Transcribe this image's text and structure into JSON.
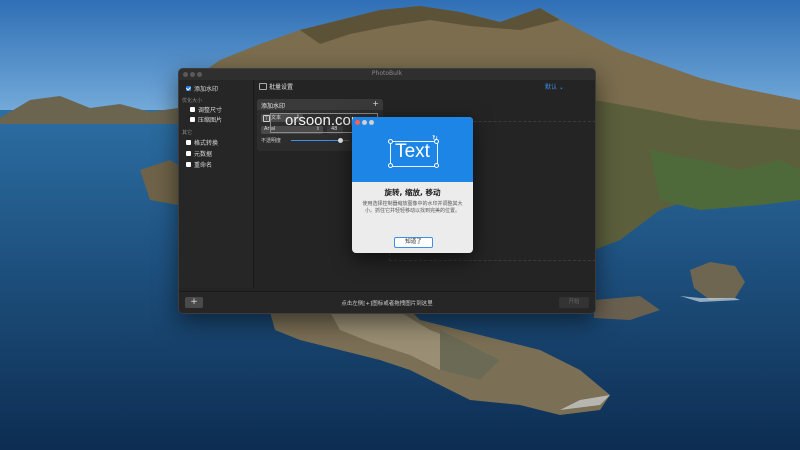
{
  "window": {
    "title": "PhotoBulk"
  },
  "sidebar": {
    "top_item": "添加水印",
    "section_resize": "调整尺寸",
    "resize_items": [
      "调整尺寸",
      "压缩图片"
    ],
    "section_other": "其它",
    "other_items": [
      "格式转换",
      "元数据",
      "重命名"
    ],
    "section_optimize": "优化大小"
  },
  "panel": {
    "title": "批量设置",
    "default_label": "默认 ⌄",
    "watermark_header": "添加水印",
    "type_label": "文本",
    "font_label": "Arial",
    "font_size": "48",
    "opacity_label": "不透明度",
    "opacity_value": 0.85
  },
  "preview": {
    "watermark_text": "orsoon.com"
  },
  "bottombar": {
    "add_label": "+",
    "hint": "点击左侧[+]图标或者拖拽图片到这里",
    "start_label": "开始"
  },
  "dialog": {
    "hero_text": "Text",
    "title": "旋转, 缩放, 移动",
    "body": "使用选择控制器缩放图像中的水印并调整其大小。抓住它并轻轻移动以找到完美的位置。",
    "button_label": "知道了"
  },
  "colors": {
    "accent": "#1d85e5",
    "window_bg": "#242424"
  }
}
